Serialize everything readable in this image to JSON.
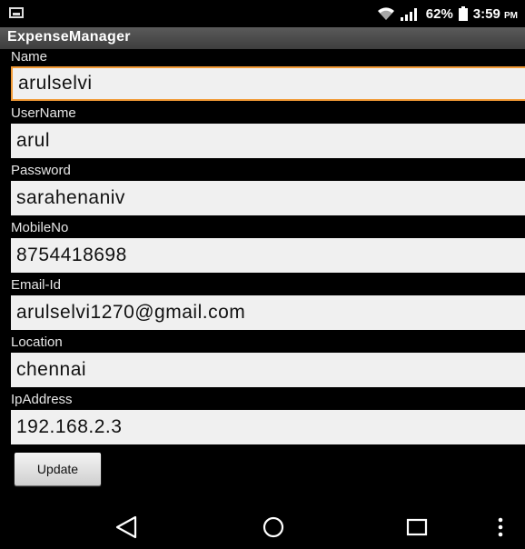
{
  "status_bar": {
    "battery": "62%",
    "time": "3:59",
    "time_suffix": "PM",
    "icons": [
      "image-icon",
      "wifi-icon",
      "signal-icon",
      "battery-icon"
    ]
  },
  "app": {
    "title": "ExpenseManager"
  },
  "form": {
    "fields": [
      {
        "label": "Name",
        "value": "arulselvi"
      },
      {
        "label": "UserName",
        "value": "arul"
      },
      {
        "label": "Password",
        "value": "sarahenaniv"
      },
      {
        "label": "MobileNo",
        "value": "8754418698"
      },
      {
        "label": "Email-Id",
        "value": "arulselvi1270@gmail.com"
      },
      {
        "label": "Location",
        "value": "chennai"
      },
      {
        "label": "IpAddress",
        "value": "192.168.2.3"
      }
    ],
    "update_label": "Update"
  },
  "nav_bar": {
    "icons": [
      "back-icon",
      "home-icon",
      "recents-icon",
      "overflow-menu-icon"
    ]
  },
  "colors": {
    "background": "#000000",
    "action_bar": "#4a4a4a",
    "input_background": "#f0f0f0",
    "focus_accent": "#f19a36"
  }
}
